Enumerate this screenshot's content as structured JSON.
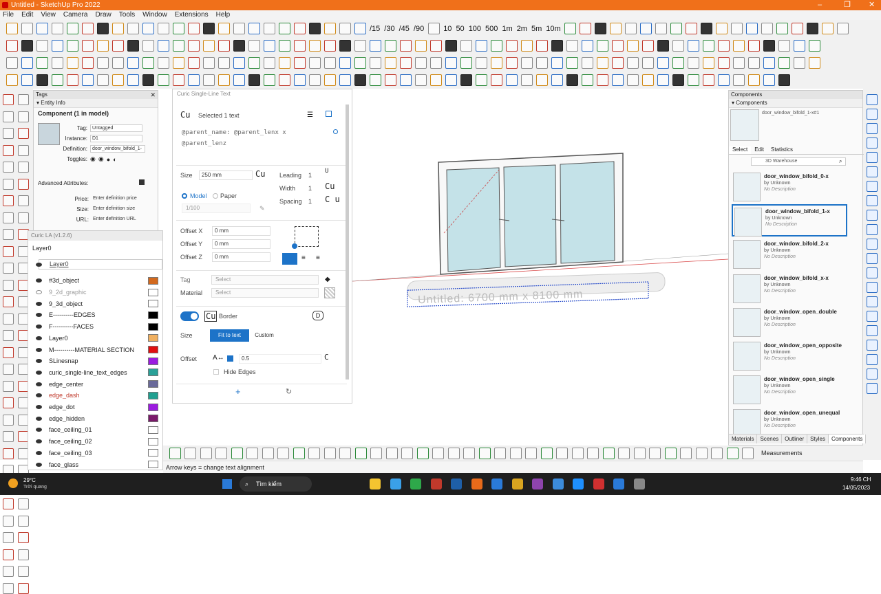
{
  "window": {
    "title": "Untitled - SketchUp Pro 2022",
    "minimize": "–",
    "maximize": "❐",
    "close": "✕"
  },
  "menu": [
    "File",
    "Edit",
    "View",
    "Camera",
    "Draw",
    "Tools",
    "Window",
    "Extensions",
    "Help"
  ],
  "toolbar": {
    "angles": [
      "/15",
      "/30",
      "/45",
      "/90"
    ],
    "sizes": [
      "10",
      "50",
      "100",
      "500",
      "1m",
      "2m",
      "5m",
      "10m"
    ]
  },
  "tags_panel": {
    "title": "Tags",
    "close": "✕"
  },
  "entity_info": {
    "header": "Entity Info",
    "title": "Component (1 in model)",
    "tag_label": "Tag:",
    "tag_value": "Untagged",
    "instance_label": "Instance:",
    "instance_value": "D1",
    "definition_label": "Definition:",
    "definition_value": "door_window_bifold_1-",
    "toggles_label": "Toggles:",
    "advanced": "Advanced Attributes:",
    "price_label": "Price:",
    "price_placeholder": "Enter definition price",
    "size_label": "Size:",
    "size_placeholder": "Enter definition size",
    "url_label": "URL:",
    "url_placeholder": "Enter definition URL"
  },
  "layers": {
    "header": "Curic LA (v1.2.6)",
    "active": "Layer0",
    "search_value": "Layer0",
    "items": [
      {
        "name": "#3d_object",
        "visible": true,
        "color": "#d2691e"
      },
      {
        "name": "9_2d_graphic",
        "visible": false,
        "color": "#ffffff"
      },
      {
        "name": "9_3d_object",
        "visible": true,
        "color": "#ffffff"
      },
      {
        "name": "E----------EDGES",
        "visible": true,
        "color": "#000000"
      },
      {
        "name": "F----------FACES",
        "visible": true,
        "color": "#000000"
      },
      {
        "name": "Layer0",
        "visible": true,
        "color": "#f0b060"
      },
      {
        "name": "M----------MATERIAL SECTION",
        "visible": true,
        "color": "#e01010"
      },
      {
        "name": "SLinesnap",
        "visible": true,
        "color": "#9b1be0"
      },
      {
        "name": "curic_single-line_text_edges",
        "visible": true,
        "color": "#2aa198"
      },
      {
        "name": "edge_center",
        "visible": true,
        "color": "#6a6a9a"
      },
      {
        "name": "edge_dash",
        "visible": true,
        "color": "#20a090"
      },
      {
        "name": "edge_dot",
        "visible": true,
        "color": "#9b1be0"
      },
      {
        "name": "edge_hidden",
        "visible": true,
        "color": "#7a1a6a"
      },
      {
        "name": "face_ceiling_01",
        "visible": true,
        "color": "#ffffff"
      },
      {
        "name": "face_ceiling_02",
        "visible": true,
        "color": "#ffffff"
      },
      {
        "name": "face_ceiling_03",
        "visible": true,
        "color": "#ffffff"
      },
      {
        "name": "face_glass",
        "visible": true,
        "color": "#ffffff"
      }
    ]
  },
  "dialog": {
    "title": "Curic Single-Line Text",
    "logo": "Cu",
    "selected": "Selected 1 text",
    "text_line1": "@parent_name: @parent_lenx x",
    "text_line2": "@parent_lenz",
    "size_label": "Size",
    "size_value": "250 mm",
    "leading_label": "Leading",
    "leading_value": "1",
    "width_label": "Width",
    "width_value": "1",
    "spacing_label": "Spacing",
    "spacing_value": "1",
    "model_label": "Model",
    "paper_label": "Paper",
    "scale_value": "1/100",
    "offx_label": "Offset X",
    "offx_value": "0 mm",
    "offy_label": "Offset Y",
    "offy_value": "0 mm",
    "offz_label": "Offset Z",
    "offz_value": "0 mm",
    "tag_label": "Tag",
    "tag_placeholder": "Select",
    "material_label": "Material",
    "material_placeholder": "Select",
    "border_label": "Border",
    "border_size_label": "Size",
    "fit_label": "Fit to text",
    "custom_label": "Custom",
    "offset_label": "Offset",
    "offset_value": "0.5",
    "hide_edges": "Hide Edges",
    "add": "+",
    "refresh": "↻"
  },
  "viewport": {
    "label_text": "Untitled: 6700 mm x 8100 mm"
  },
  "components": {
    "header": "Components",
    "name_field": "door_window_bifold_1-x#1",
    "tabs": [
      "Select",
      "Edit",
      "Statistics"
    ],
    "search_placeholder": "3D Warehouse",
    "items": [
      {
        "name": "door_window_bifold_0-x",
        "by": "by Unknown",
        "desc": "No Description"
      },
      {
        "name": "door_window_bifold_1-x",
        "by": "by Unknown",
        "desc": "No Description"
      },
      {
        "name": "door_window_bifold_2-x",
        "by": "by Unknown",
        "desc": "No Description"
      },
      {
        "name": "door_window_bifold_x-x",
        "by": "by Unknown",
        "desc": "No Description"
      },
      {
        "name": "door_window_open_double",
        "by": "by Unknown",
        "desc": "No Description"
      },
      {
        "name": "door_window_open_opposite",
        "by": "by Unknown",
        "desc": "No Description"
      },
      {
        "name": "door_window_open_single",
        "by": "by Unknown",
        "desc": "No Description"
      },
      {
        "name": "door_window_open_unequal",
        "by": "by Unknown",
        "desc": "No Description"
      }
    ],
    "bottom_tabs": [
      "Materials",
      "Scenes",
      "Outliner",
      "Styles",
      "Components"
    ]
  },
  "status": {
    "hint": "Arrow keys = change text alignment",
    "measurements": "Measurements"
  },
  "taskbar": {
    "temp": "29°C",
    "weather": "Trời quang",
    "search": "Tìm kiếm",
    "time": "9:46 CH",
    "date": "14/05/2023"
  }
}
